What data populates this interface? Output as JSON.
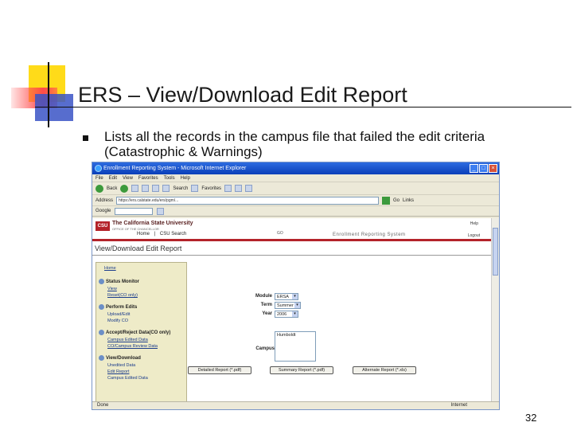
{
  "slide": {
    "title": "ERS – View/Download Edit Report",
    "bullet": "Lists all the records in the campus file that failed the edit criteria (Catastrophic & Warnings)",
    "page_number": "32"
  },
  "browser": {
    "window_title": "Enrollment Reporting System - Microsoft Internet Explorer",
    "menu": [
      "File",
      "Edit",
      "View",
      "Favorites",
      "Tools",
      "Help"
    ],
    "toolbar": {
      "back": "Back",
      "search": "Search",
      "favorites": "Favorites"
    },
    "address_label": "Address",
    "address_value": "https://ers.calstate.edu/ers/pgm/...",
    "go_label": "Go",
    "links_label": "Links",
    "google_label": "Google",
    "status_text": "Done",
    "status_zone": "Internet"
  },
  "app": {
    "logo_text": "CSU",
    "org_name": "The California State University",
    "org_sub": "OFFICE OF THE CHANCELLOR",
    "nav": [
      "Home",
      "|",
      "CSU Search"
    ],
    "go_tag": "GO",
    "system_name": "Enrollment Reporting System",
    "help": "Help",
    "logout": "Logout",
    "page_title": "View/Download Edit Report"
  },
  "sidebar": {
    "home": "Home",
    "status_monitor": "Status Monitor",
    "view": "View",
    "reset": "Reset(CO only)",
    "perform_edits": "Perform Edits",
    "upload_edit": "Upload/Edit",
    "modify_co": "Modify CO",
    "accept_reject": "Accept/Reject Data(CO only)",
    "campus_edited": "Campus Edited Data",
    "campus_review": "CO/Campus Review Data",
    "view_download": "View/Download",
    "unedited": "Unedited Data",
    "edit_report": "Edit Report",
    "campus_edited_2": "Campus Edited Data"
  },
  "form": {
    "module_label": "Module",
    "module_value": "ERSA",
    "term_label": "Term",
    "term_value": "Summer",
    "year_label": "Year",
    "year_value": "2006",
    "campus_label": "Campus",
    "campus_option": "Humboldt"
  },
  "buttons": {
    "detailed": "Detailed Report (*.pdf)",
    "summary": "Summary Report (*.pdf)",
    "alternate": "Alternate Report (*.xls)"
  }
}
